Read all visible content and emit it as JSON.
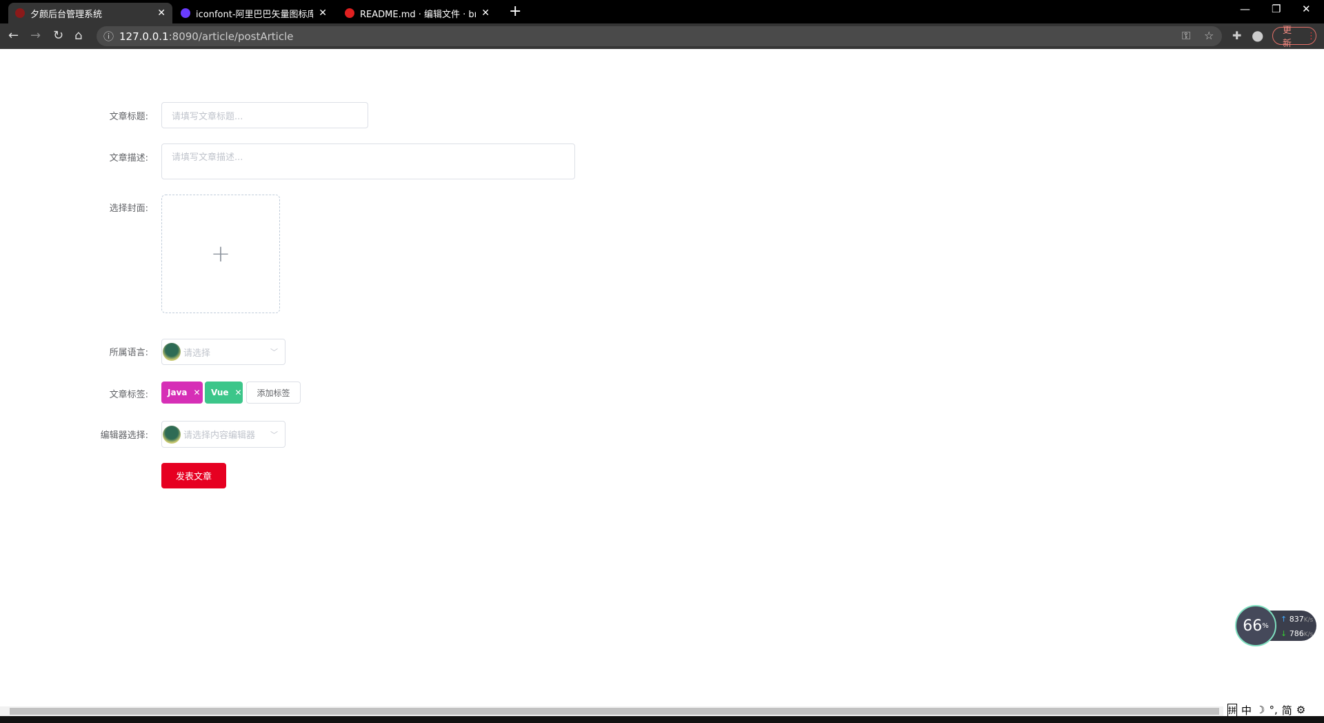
{
  "browser": {
    "tabs": [
      {
        "title": "夕颜后台管理系统",
        "active": true,
        "favicon_color": "#8b1a1a"
      },
      {
        "title": "iconfont-阿里巴巴矢量图标库",
        "active": false,
        "favicon_color": "#6a3cff"
      },
      {
        "title": "README.md · 编辑文件 · bright",
        "active": false,
        "favicon_color": "#e02020"
      }
    ],
    "url_host": "127.0.0.1",
    "url_rest": ":8090/article/postArticle",
    "update_label": "更新"
  },
  "form": {
    "title_label": "文章标题:",
    "title_placeholder": "请填写文章标题...",
    "desc_label": "文章描述:",
    "desc_placeholder": "请填写文章描述...",
    "cover_label": "选择封面:",
    "language_label": "所属语言:",
    "language_placeholder": "请选择",
    "tags_label": "文章标签:",
    "tags": [
      {
        "name": "Java",
        "color": "#d62fb6"
      },
      {
        "name": "Vue",
        "color": "#3cc68a"
      }
    ],
    "add_tag_label": "添加标签",
    "editor_label": "编辑器选择:",
    "editor_placeholder": "请选择内容编辑器",
    "submit_label": "发表文章"
  },
  "widget": {
    "cpu": "66",
    "cpu_unit": "%",
    "up": "837",
    "down": "786",
    "unit": "K/s"
  },
  "ime": [
    "拼",
    "中",
    "☽",
    "°,",
    "简",
    "⚙"
  ]
}
